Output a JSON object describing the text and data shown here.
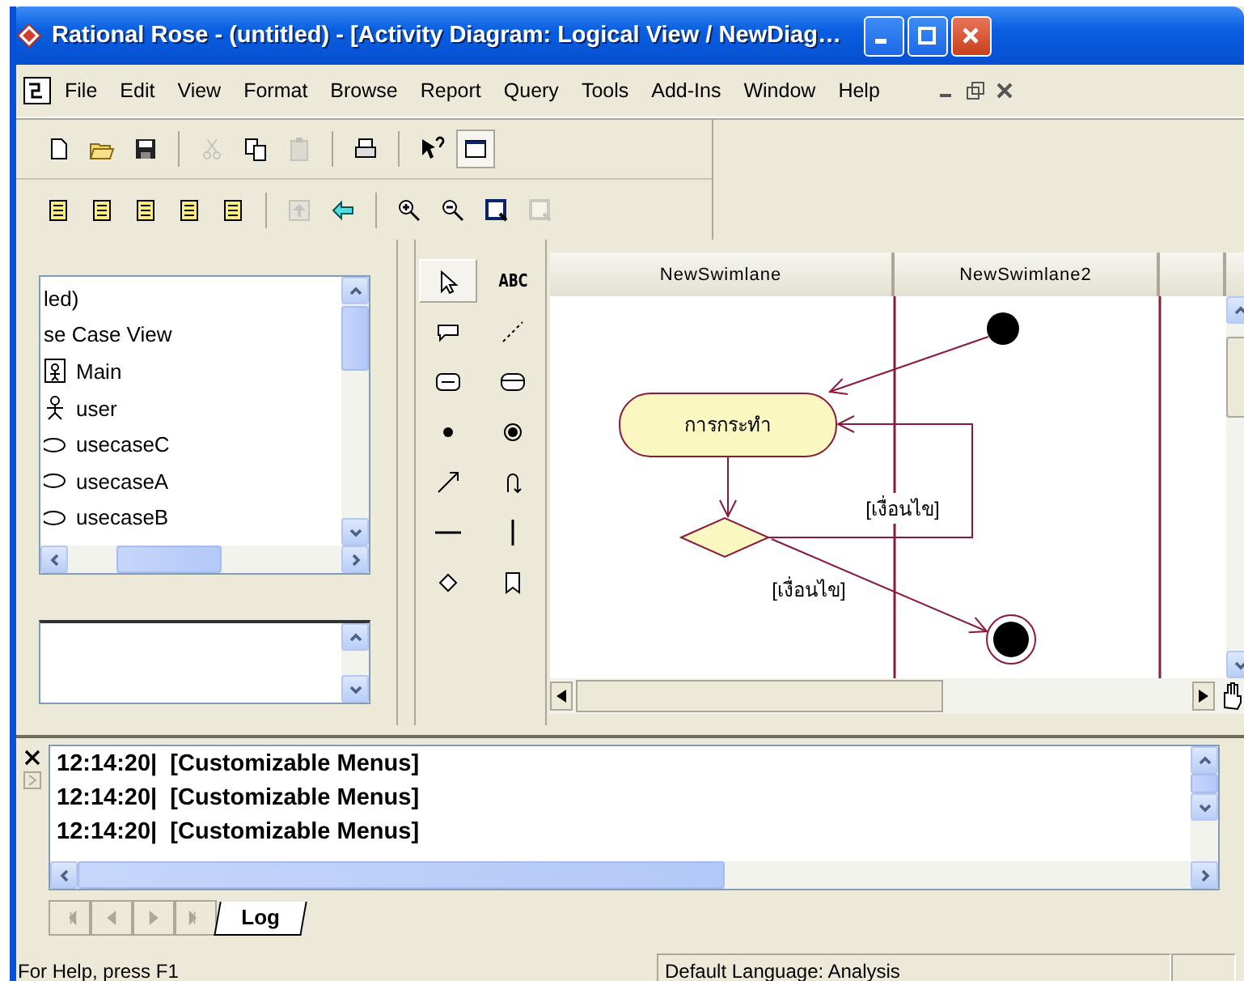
{
  "window": {
    "title": "Rational Rose - (untitled) - [Activity Diagram: Logical View / NewDiag…"
  },
  "menu": [
    "File",
    "Edit",
    "View",
    "Format",
    "Browse",
    "Report",
    "Query",
    "Tools",
    "Add-Ins",
    "Window",
    "Help"
  ],
  "toolbars": [
    [
      {
        "kind": "new",
        "disabled": false,
        "pressed": false
      },
      {
        "kind": "open",
        "disabled": false,
        "pressed": false
      },
      {
        "kind": "save",
        "disabled": false,
        "pressed": false
      },
      {
        "kind": "separator"
      },
      {
        "kind": "cut",
        "disabled": true,
        "pressed": false
      },
      {
        "kind": "copy",
        "disabled": false,
        "pressed": false
      },
      {
        "kind": "paste",
        "disabled": true,
        "pressed": false
      },
      {
        "kind": "separator"
      },
      {
        "kind": "print",
        "disabled": false,
        "pressed": false
      },
      {
        "kind": "separator"
      },
      {
        "kind": "context-help",
        "disabled": false,
        "pressed": false
      },
      {
        "kind": "window",
        "disabled": false,
        "pressed": true
      }
    ],
    [
      {
        "kind": "doc",
        "disabled": false,
        "pressed": false
      },
      {
        "kind": "doc",
        "disabled": false,
        "pressed": false
      },
      {
        "kind": "doc",
        "disabled": false,
        "pressed": false
      },
      {
        "kind": "doc",
        "disabled": false,
        "pressed": false
      },
      {
        "kind": "doc",
        "disabled": false,
        "pressed": false
      },
      {
        "kind": "separator"
      },
      {
        "kind": "up",
        "disabled": true,
        "pressed": false
      },
      {
        "kind": "back",
        "disabled": false,
        "pressed": false
      },
      {
        "kind": "separator"
      },
      {
        "kind": "zoom-in",
        "disabled": false,
        "pressed": false
      },
      {
        "kind": "zoom-out",
        "disabled": false,
        "pressed": false
      },
      {
        "kind": "fit",
        "disabled": false,
        "pressed": false
      },
      {
        "kind": "fit",
        "disabled": true,
        "pressed": false
      }
    ]
  ],
  "browser": {
    "items": [
      {
        "kind": "text",
        "label": "led)"
      },
      {
        "kind": "text",
        "label": "se Case View"
      },
      {
        "kind": "diagram",
        "label": "Main"
      },
      {
        "kind": "actor",
        "label": "user"
      },
      {
        "kind": "usecase",
        "label": "usecaseC"
      },
      {
        "kind": "usecase",
        "label": "usecaseA"
      },
      {
        "kind": "usecase",
        "label": "usecaseB"
      }
    ]
  },
  "toolbox": {
    "tools": [
      {
        "kind": "pointer",
        "selected": true
      },
      {
        "kind": "text",
        "label": "ABC",
        "selected": false
      },
      {
        "kind": "note",
        "selected": false
      },
      {
        "kind": "anchor",
        "selected": false
      },
      {
        "kind": "state",
        "selected": false
      },
      {
        "kind": "activity",
        "selected": false
      },
      {
        "kind": "start",
        "selected": false
      },
      {
        "kind": "end",
        "selected": false
      },
      {
        "kind": "transition",
        "selected": false
      },
      {
        "kind": "loop",
        "selected": false
      },
      {
        "kind": "hsync",
        "selected": false
      },
      {
        "kind": "vsync",
        "selected": false
      },
      {
        "kind": "decision",
        "selected": false
      },
      {
        "kind": "swimlane",
        "selected": false
      }
    ]
  },
  "diagram": {
    "swimlanes": [
      "NewSwimlane",
      "NewSwimlane2"
    ],
    "activity": "การกระทำ",
    "guards": [
      "[เงื่อนไข]",
      "[เงื่อนไข]"
    ]
  },
  "log": {
    "lines": [
      "12:14:20|  [Customizable Menus]",
      "12:14:20|  [Customizable Menus]",
      "12:14:20|  [Customizable Menus]"
    ],
    "tabs": [
      {
        "label": "Log",
        "selected": true
      }
    ]
  },
  "status_bar": [
    "For Help, press F1",
    "Default Language: Analysis"
  ]
}
